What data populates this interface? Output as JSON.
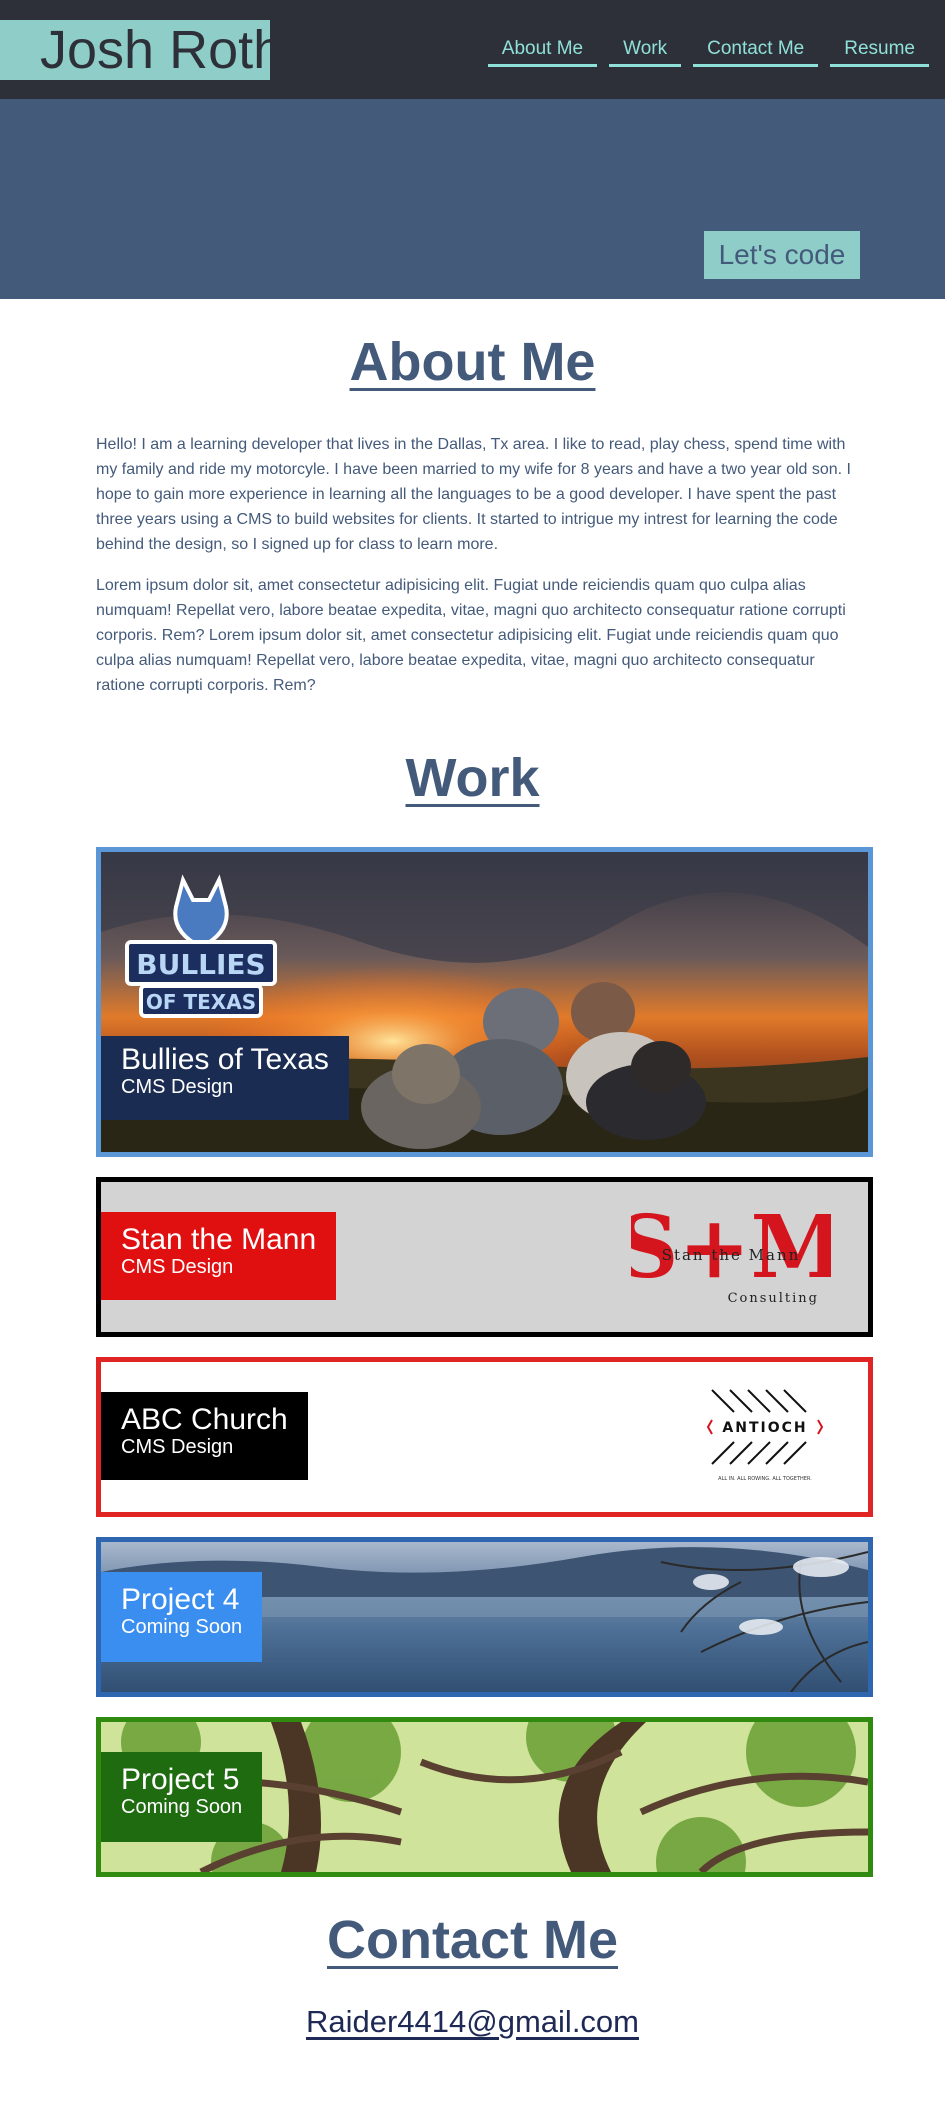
{
  "header": {
    "brand": "Josh Roth",
    "nav": [
      "About Me",
      "Work",
      "Contact Me",
      "Resume"
    ],
    "cta": "Let's code"
  },
  "about": {
    "title": "About Me",
    "p1": "Hello! I am a learning developer that lives in the Dallas, Tx area. I like to read, play chess, spend time with my family and ride my motorcyle. I have been married to my wife for 8 years and have a two year old son. I hope to gain more experience in learning all the languages to be a good developer. I have spent the past three years using a CMS to build websites for clients. It started to intrigue my intrest for learning the code behind the design, so I signed up for class to learn more.",
    "p2": "Lorem ipsum dolor sit, amet consectetur adipisicing elit. Fugiat unde reiciendis quam quo culpa alias numquam! Repellat vero, labore beatae expedita, vitae, magni quo architecto consequatur ratione corrupti corporis. Rem? Lorem ipsum dolor sit, amet consectetur adipisicing elit. Fugiat unde reiciendis quam quo culpa alias numquam! Repellat vero, labore beatae expedita, vitae, magni quo architecto consequatur ratione corrupti corporis. Rem?"
  },
  "work": {
    "title": "Work",
    "projects": [
      {
        "title": "Bullies of Texas",
        "subtitle": "CMS Design",
        "border": "#5b97d6",
        "label_bg": "#1a2c52",
        "logo_line1": "BULLIES",
        "logo_line2": "OF TEXAS"
      },
      {
        "title": "Stan the Mann",
        "subtitle": "CMS Design",
        "border": "#000000",
        "label_bg": "#e01010",
        "logo_big": "S+M",
        "logo_mid": "Stan the Mann",
        "logo_small": "Consulting"
      },
      {
        "title": "ABC Church",
        "subtitle": "CMS Design",
        "border": "#e12525",
        "label_bg": "#000000",
        "logo_word": "ANTIOCH",
        "logo_tag": "ALL IN. ALL ROWING. ALL TOGETHER."
      },
      {
        "title": "Project 4",
        "subtitle": "Coming Soon",
        "border": "#2f66b0",
        "label_bg": "#3a8ef0"
      },
      {
        "title": "Project 5",
        "subtitle": "Coming Soon",
        "border": "#2f8a0f",
        "label_bg": "#1e6b10"
      }
    ]
  },
  "contact": {
    "title": "Contact Me",
    "email": "Raider4414@gmail.com"
  },
  "colors": {
    "dark": "#2e3039",
    "slate": "#445a7a",
    "teal": "#8fcdc8",
    "nav_text": "#8fe0d8"
  }
}
